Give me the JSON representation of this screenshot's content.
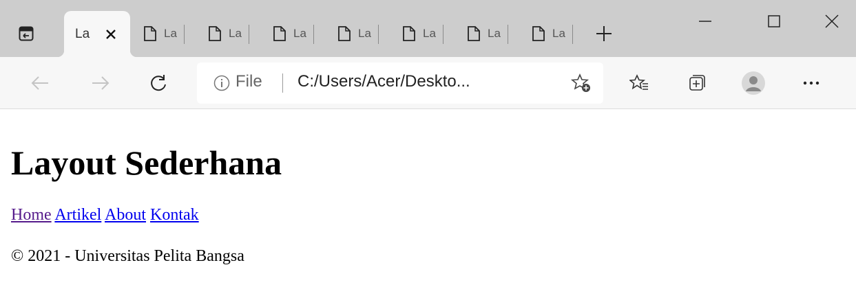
{
  "browser": {
    "active_tab_title": "La",
    "inactive_tab_title": "La",
    "inactive_tab_count": 7,
    "address": {
      "scheme_label": "File",
      "url": "C:/Users/Acer/Deskto..."
    }
  },
  "page": {
    "title": "Layout Sederhana",
    "nav": [
      {
        "label": "Home",
        "visited": true
      },
      {
        "label": "Artikel",
        "visited": false
      },
      {
        "label": "About",
        "visited": false
      },
      {
        "label": "Kontak",
        "visited": false
      }
    ],
    "footer": "© 2021 - Universitas Pelita Bangsa"
  },
  "colors": {
    "link": "#0000ee",
    "visited_link": "#551a8b",
    "tabstrip": "#cdcdcd",
    "toolbar": "#f7f7f7"
  }
}
